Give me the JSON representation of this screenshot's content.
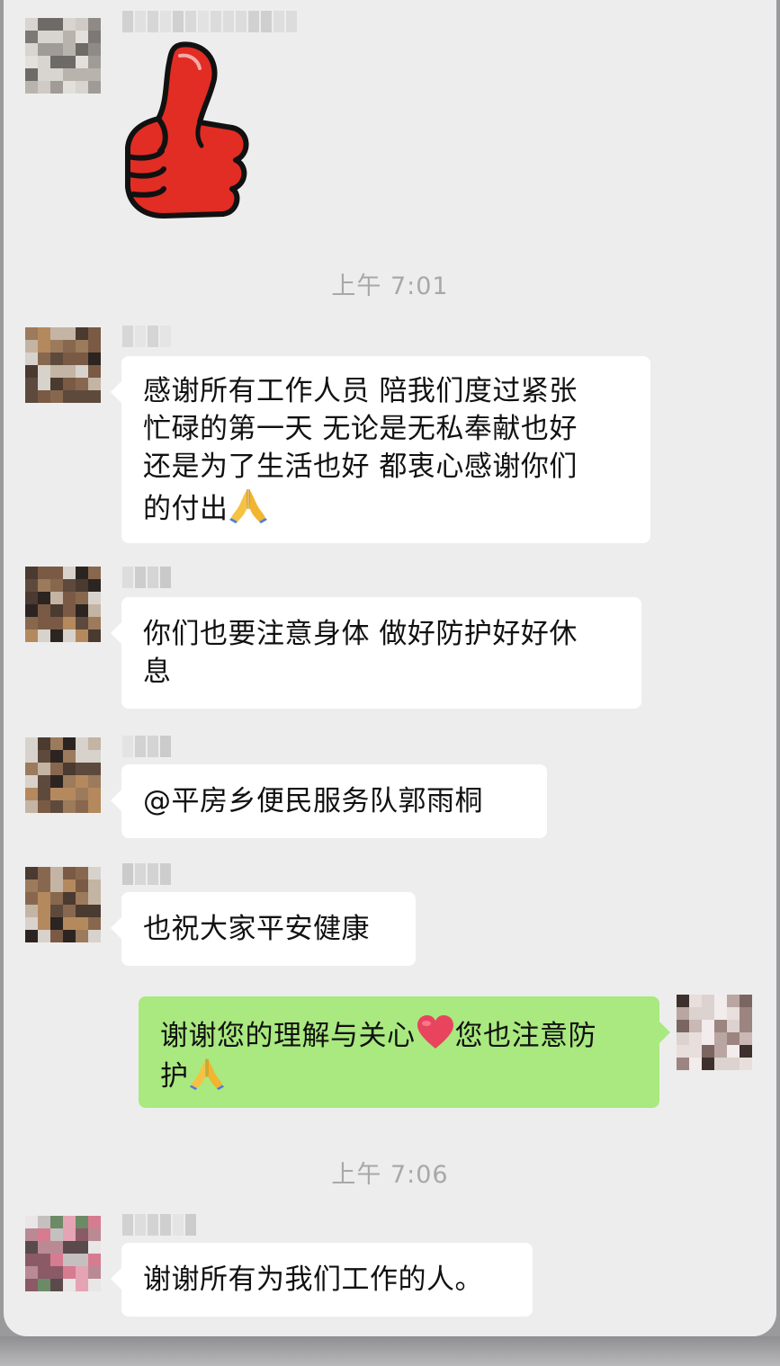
{
  "theme": {
    "background": "#ededed",
    "incoming_bubble": "#ffffff",
    "outgoing_bubble": "#a9e97f",
    "timestamp_color": "#a8a8a8"
  },
  "timestamps": [
    "上午 7:01",
    "上午 7:06"
  ],
  "messages": [
    {
      "type": "sticker",
      "sender": "incoming",
      "sticker": "red-thumbs-up-icon"
    },
    {
      "type": "text",
      "sender": "incoming",
      "lines": [
        "感谢所有工作人员 陪我们度过紧张",
        "忙碌的第一天 无论是无私奉献也好",
        "还是为了生活也好 都衷心感谢你们",
        "的付出"
      ],
      "emoji": "folded-hands-icon"
    },
    {
      "type": "text",
      "sender": "incoming",
      "lines": [
        "你们也要注意身体 做好防护好好休",
        "息"
      ]
    },
    {
      "type": "text",
      "sender": "incoming",
      "lines": [
        "@平房乡便民服务队郭雨桐"
      ]
    },
    {
      "type": "text",
      "sender": "incoming",
      "lines": [
        "也祝大家平安健康"
      ]
    },
    {
      "type": "text",
      "sender": "outgoing",
      "parts": [
        "谢谢您的理解与关心",
        "您也注意防",
        "护"
      ],
      "emojis": [
        "red-heart-icon",
        "folded-hands-icon"
      ]
    },
    {
      "type": "text",
      "sender": "incoming",
      "lines": [
        "谢谢所有为我们工作的人。"
      ]
    }
  ]
}
